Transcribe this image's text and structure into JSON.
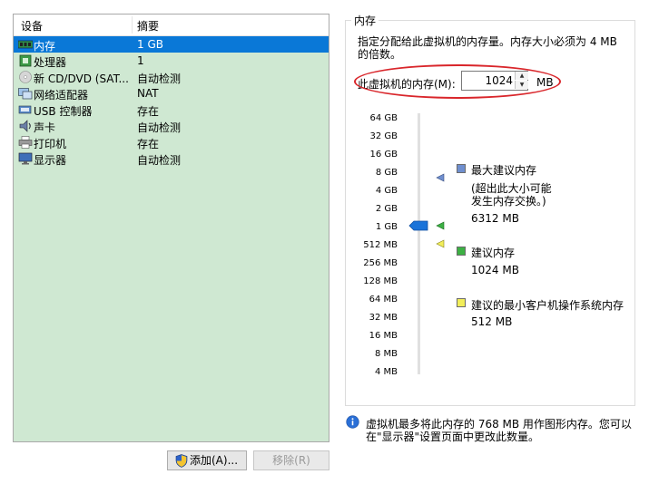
{
  "device_list": {
    "headers": {
      "device": "设备",
      "summary": "摘要"
    },
    "rows": [
      {
        "name": "内存",
        "summary": "1 GB",
        "icon": "memory-icon",
        "selected": true
      },
      {
        "name": "处理器",
        "summary": "1",
        "icon": "processor-icon"
      },
      {
        "name": "新 CD/DVD (SAT...",
        "summary": "自动检测",
        "icon": "cd-dvd-icon"
      },
      {
        "name": "网络适配器",
        "summary": "NAT",
        "icon": "network-adapter-icon"
      },
      {
        "name": "USB 控制器",
        "summary": "存在",
        "icon": "usb-icon"
      },
      {
        "name": "声卡",
        "summary": "自动检测",
        "icon": "sound-card-icon"
      },
      {
        "name": "打印机",
        "summary": "存在",
        "icon": "printer-icon"
      },
      {
        "name": "显示器",
        "summary": "自动检测",
        "icon": "display-icon"
      }
    ]
  },
  "buttons": {
    "add": "添加(A)...",
    "remove": "移除(R)"
  },
  "memory": {
    "group_title": "内存",
    "description_line1": "指定分配给此虚拟机的内存量。内存大小必须为 4 MB",
    "description_line2": "的倍数。",
    "field_label": "此虚拟机的内存(M):",
    "value": "1024",
    "unit": "MB",
    "ticks": [
      "64 GB",
      "32 GB",
      "16 GB",
      "8 GB",
      "4 GB",
      "2 GB",
      "1 GB",
      "512 MB",
      "256 MB",
      "128 MB",
      "64 MB",
      "32 MB",
      "16 MB",
      "8 MB",
      "4 MB"
    ],
    "max": {
      "title": "最大建议内存",
      "note1": "(超出此大小可能",
      "note2": "发生内存交换。)",
      "value": "6312 MB",
      "color": "#6f8fcf"
    },
    "recommended": {
      "title": "建议内存",
      "value": "1024 MB",
      "color": "#3cb043"
    },
    "min": {
      "title": "建议的最小客户机操作系统内存",
      "value": "512 MB",
      "color": "#f2ee5a"
    },
    "info_line1": "虚拟机最多将此内存的 768 MB 用作图形内存。您可以",
    "info_line2": "在\"显示器\"设置页面中更改此数量。"
  }
}
